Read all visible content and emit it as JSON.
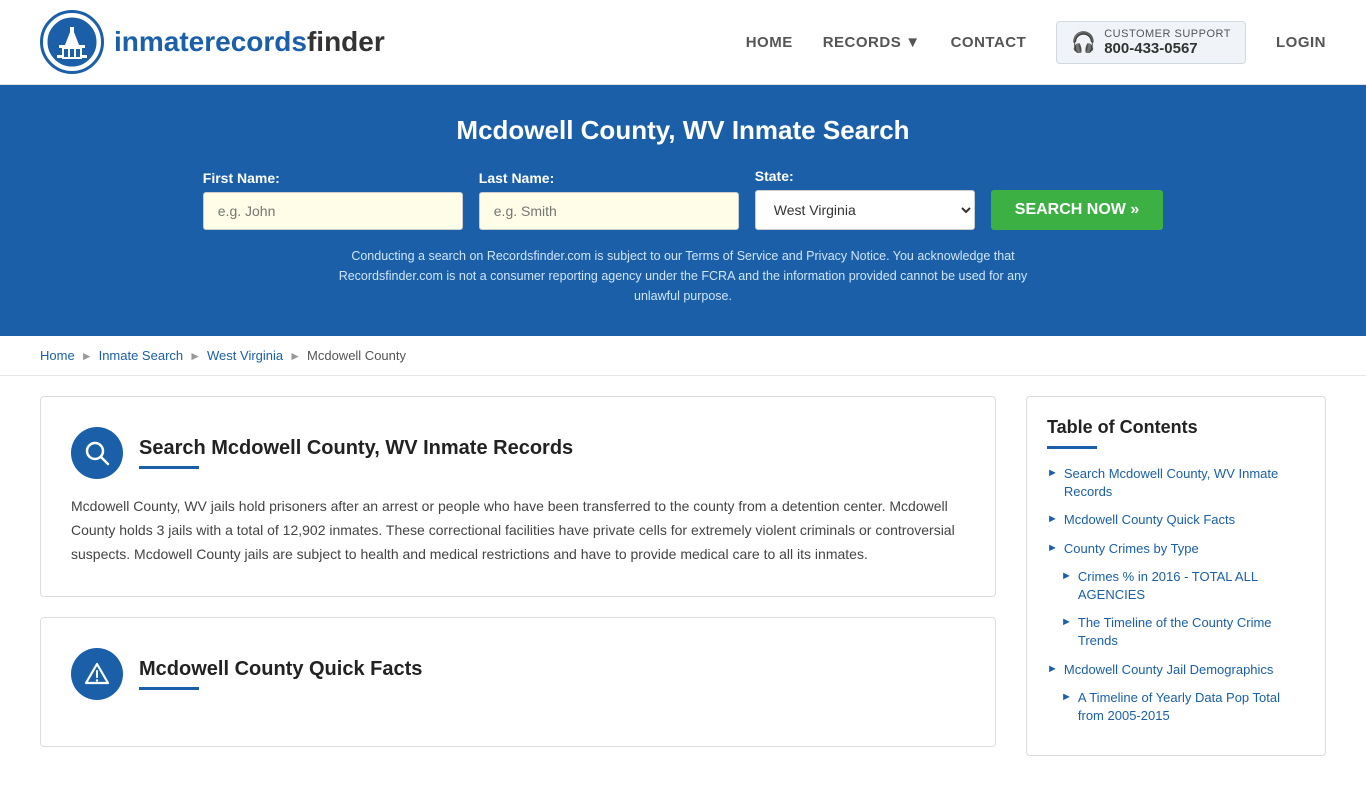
{
  "header": {
    "logo_text_main": "inmaterecords",
    "logo_text_bold": "finder",
    "nav": {
      "home_label": "HOME",
      "records_label": "RECORDS",
      "contact_label": "CONTACT",
      "support_label": "CUSTOMER SUPPORT",
      "support_phone": "800-433-0567",
      "login_label": "LOGIN"
    }
  },
  "hero": {
    "title": "Mcdowell County, WV Inmate Search",
    "first_name_label": "First Name:",
    "first_name_placeholder": "e.g. John",
    "last_name_label": "Last Name:",
    "last_name_placeholder": "e.g. Smith",
    "state_label": "State:",
    "state_value": "West Virginia",
    "search_button": "SEARCH NOW »",
    "disclaimer": "Conducting a search on Recordsfinder.com is subject to our Terms of Service and Privacy Notice. You acknowledge that Recordsfinder.com is not a consumer reporting agency under the FCRA and the information provided cannot be used for any unlawful purpose."
  },
  "breadcrumb": {
    "home": "Home",
    "inmate_search": "Inmate Search",
    "west_virginia": "West Virginia",
    "mcdowell_county": "Mcdowell County"
  },
  "main_section": {
    "title": "Search Mcdowell County, WV Inmate Records",
    "body": "Mcdowell County, WV jails hold prisoners after an arrest or people who have been transferred to the county from a detention center. Mcdowell County holds 3 jails with a total of 12,902 inmates. These correctional facilities have private cells for extremely violent criminals or controversial suspects. Mcdowell County jails are subject to health and medical restrictions and have to provide medical care to all its inmates."
  },
  "quick_facts_section": {
    "title": "Mcdowell County Quick Facts"
  },
  "toc": {
    "title": "Table of Contents",
    "items": [
      {
        "label": "Search Mcdowell County, WV Inmate Records",
        "sub": false
      },
      {
        "label": "Mcdowell County Quick Facts",
        "sub": false
      },
      {
        "label": "County Crimes by Type",
        "sub": false
      },
      {
        "label": "Crimes % in 2016 - TOTAL ALL AGENCIES",
        "sub": true
      },
      {
        "label": "The Timeline of the County Crime Trends",
        "sub": true
      },
      {
        "label": "Mcdowell County Jail Demographics",
        "sub": false
      },
      {
        "label": "A Timeline of Yearly Data Pop Total from 2005-2015",
        "sub": true
      }
    ]
  }
}
